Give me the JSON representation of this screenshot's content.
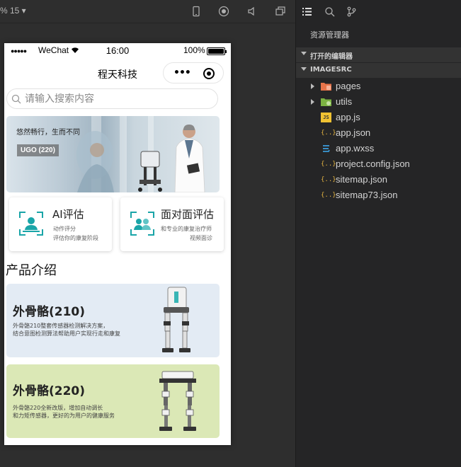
{
  "simulator": {
    "zoom_label": "% 15 ▾",
    "toolbar_icons": [
      "phone-icon",
      "record-icon",
      "sound-icon",
      "window-icon"
    ]
  },
  "phone": {
    "status": {
      "signal": "●●●●●",
      "carrier": "WeChat",
      "time": "16:00",
      "battery": "100%"
    },
    "nav_title": "程天科技",
    "capsule_menu": "•••",
    "search": {
      "placeholder": "请输入搜索内容"
    },
    "banner": {
      "slogan": "悠然畅行，生而不同",
      "tag": "UGO (220)"
    },
    "eval_cards": [
      {
        "title": "AI评估",
        "sub1": "动作评分",
        "sub2": "评估你的康复阶段",
        "accent": "#1aa5a8"
      },
      {
        "title": "面对面评估",
        "sub1": "和专业的康复治疗师",
        "sub2": "视频面诊",
        "accent": "#1aa5a8"
      }
    ],
    "section_title": "产品介绍",
    "products": [
      {
        "name": "外骨骼(210)",
        "desc1": "外骨骼210整套传感器检测解决方案，",
        "desc2": "结合意图检测算法帮助用户实现行走和康复",
        "bg": "#e3ebf4"
      },
      {
        "name": "外骨骼(220)",
        "desc1": "外骨骼220全新改版，增加自动调长",
        "desc2": "和力矩传感器，更好的为用户的健康服务",
        "bg": "#dbe8b6"
      }
    ]
  },
  "explorer": {
    "toolbar_icons": [
      "list-icon",
      "search-icon",
      "branch-icon"
    ],
    "title": "资源管理器",
    "sections": [
      {
        "label": "打开的编辑器"
      },
      {
        "label": "IMAGESRC"
      }
    ],
    "tree": [
      {
        "name": "pages",
        "type": "folder",
        "icon": "pages-folder-icon",
        "color": "#e8744a"
      },
      {
        "name": "utils",
        "type": "folder",
        "icon": "utils-folder-icon",
        "color": "#7cb342"
      },
      {
        "name": "app.js",
        "type": "file",
        "icon": "js-file-icon",
        "color": "#f1c232"
      },
      {
        "name": "app.json",
        "type": "file",
        "icon": "json-file-icon",
        "color": "#e3b341"
      },
      {
        "name": "app.wxss",
        "type": "file",
        "icon": "wxss-file-icon",
        "color": "#3a9ad9"
      },
      {
        "name": "project.config.json",
        "type": "file",
        "icon": "json-file-icon",
        "color": "#e3b341"
      },
      {
        "name": "sitemap.json",
        "type": "file",
        "icon": "json-file-icon",
        "color": "#e3b341"
      },
      {
        "name": "sitemap73.json",
        "type": "file",
        "icon": "json-file-icon",
        "color": "#e3b341"
      }
    ]
  }
}
